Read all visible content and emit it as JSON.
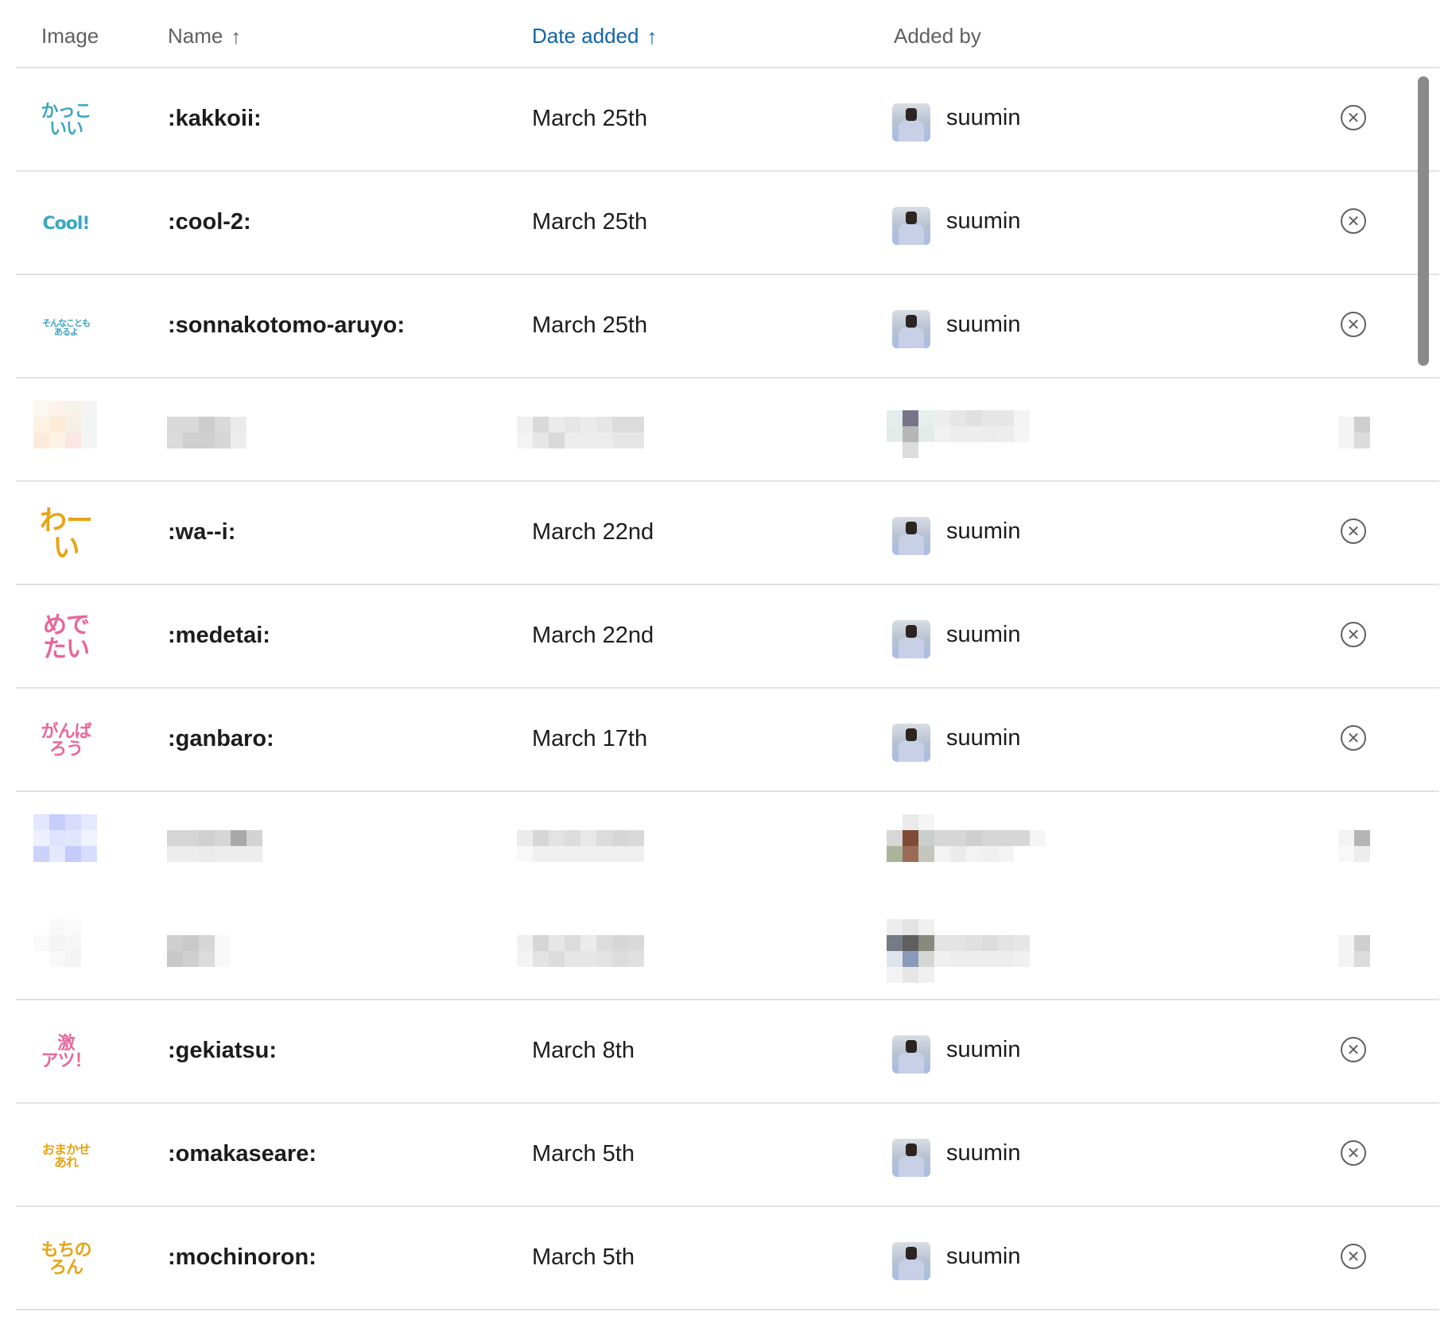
{
  "header": {
    "image": "Image",
    "name": "Name",
    "date_added": "Date added",
    "added_by": "Added by",
    "sort_arrow": "↑"
  },
  "rows": [
    {
      "name": ":kakkoii:",
      "date": "March 25th",
      "added_by": "suumin",
      "emoji_lines": [
        "かっこ",
        "いい"
      ],
      "emoji_color": "#3aa6c2"
    },
    {
      "name": ":cool-2:",
      "date": "March 25th",
      "added_by": "suumin",
      "emoji_lines": [
        "Cool!"
      ],
      "emoji_color": "#3aa6c2"
    },
    {
      "name": ":sonnakotomo-aruyo:",
      "date": "March 25th",
      "added_by": "suumin",
      "emoji_lines": [
        "そんなことも",
        "あるよ"
      ],
      "emoji_color": "#3aa6c2"
    },
    {
      "name": ":wa--i:",
      "date": "March 22nd",
      "added_by": "suumin",
      "emoji_lines": [
        "わーい"
      ],
      "emoji_color": "#e6a417"
    },
    {
      "name": ":medetai:",
      "date": "March 22nd",
      "added_by": "suumin",
      "emoji_lines": [
        "めで",
        "たい"
      ],
      "emoji_color": "#e8679b"
    },
    {
      "name": ":ganbaro:",
      "date": "March 17th",
      "added_by": "suumin",
      "emoji_lines": [
        "がんば",
        "ろう"
      ],
      "emoji_color": "#e8679b"
    },
    {
      "name": ":gekiatsu:",
      "date": "March 8th",
      "added_by": "suumin",
      "emoji_lines": [
        "激",
        "アツ！"
      ],
      "emoji_color": "#e8679b"
    },
    {
      "name": ":omakaseare:",
      "date": "March 5th",
      "added_by": "suumin",
      "emoji_lines": [
        "おまかせ",
        "あれ"
      ],
      "emoji_color": "#e6a417"
    },
    {
      "name": ":mochinoron:",
      "date": "March 5th",
      "added_by": "suumin",
      "emoji_lines": [
        "もちの",
        "ろん"
      ],
      "emoji_color": "#e6a417"
    }
  ],
  "icons": {
    "remove": "close-circle-icon",
    "sort": "arrow-up-icon"
  },
  "colors": {
    "accent": "#1264a3",
    "header_text": "#616061",
    "divider": "#e2e2e2"
  }
}
